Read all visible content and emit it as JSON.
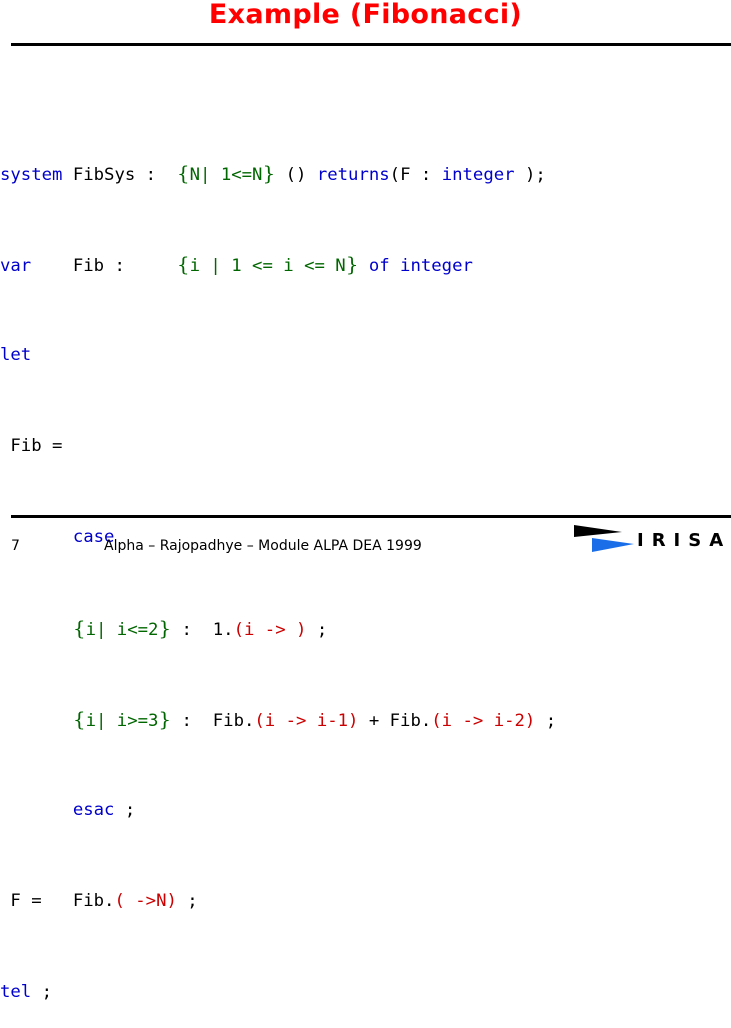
{
  "slide": {
    "title": "Example (Fibonacci)",
    "footer": {
      "page_number": "7",
      "text": "Alpha – Rajopadhye – Module ALPA DEA 1999",
      "logo_text": "IRISA"
    }
  },
  "colors": {
    "title": "#ff0000",
    "keyword": "#0000cc",
    "domain": "#006600",
    "dependency": "#cc0000"
  },
  "code": {
    "l1": {
      "kw": "system",
      "a": " FibSys :  ",
      "dom_open": "{",
      "dom": "N| 1<=N",
      "dom_close": "}",
      "b": " () ",
      "kw2": "returns",
      "c": "(F : ",
      "kw3": "integer",
      "d": " );"
    },
    "l2": {
      "kw": "var",
      "a": "    Fib :     ",
      "dom_open": "{",
      "dom": "i | 1 <= i <= N",
      "dom_close": "}",
      "b": " ",
      "kw2": "of integer"
    },
    "l3": {
      "kw": "let"
    },
    "l4": {
      "a": " Fib ="
    },
    "l5": {
      "pad": "       ",
      "kw": "case"
    },
    "l6": {
      "pad": "       ",
      "dom_open": "{",
      "dom": "i| i<=2",
      "dom_close": "}",
      "a": " :  1.",
      "dep": "(i -> )",
      "b": " ;"
    },
    "l7": {
      "pad": "       ",
      "dom_open": "{",
      "dom": "i| i>=3",
      "dom_close": "}",
      "a": " :  Fib.",
      "dep": "(i -> i-1)",
      "b": " + Fib.",
      "dep2": "(i -> i-2)",
      "c": " ;"
    },
    "l8": {
      "pad": "       ",
      "kw": "esac",
      "a": " ;"
    },
    "l9": {
      "a": " F =   Fib.",
      "dep": "( ->N)",
      "b": " ;"
    },
    "l10": {
      "kw": "tel",
      "a": " ;"
    }
  }
}
